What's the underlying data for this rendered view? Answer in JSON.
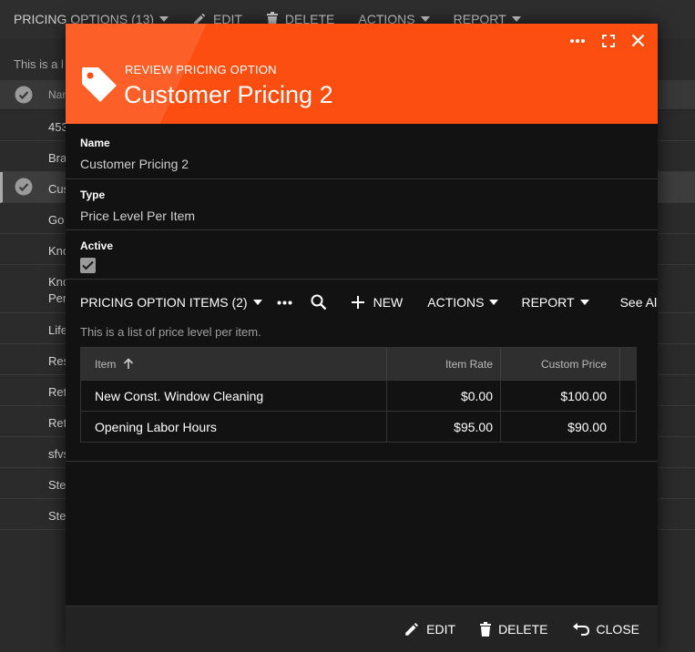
{
  "background": {
    "toolbar": {
      "list_title": "PRICING OPTIONS (13)",
      "edit": "EDIT",
      "delete": "DELETE",
      "actions": "ACTIONS",
      "report": "REPORT"
    },
    "description": "This is a l",
    "column_header": "Nar",
    "rows": [
      "453",
      "Bra",
      "Cus",
      "Go",
      "Kno",
      "Kno\nPer",
      "Life",
      "Res",
      "Ret",
      "Ret",
      "sfvs",
      "Ste",
      "Ste"
    ]
  },
  "modal": {
    "subtitle": "REVIEW PRICING OPTION",
    "title": "Customer Pricing 2",
    "fields": {
      "name_label": "Name",
      "name_value": "Customer Pricing 2",
      "type_label": "Type",
      "type_value": "Price Level Per Item",
      "active_label": "Active",
      "active_checked": true
    },
    "items_toolbar": {
      "title": "PRICING OPTION ITEMS (2)",
      "new": "NEW",
      "actions": "ACTIONS",
      "report": "REPORT",
      "see_all": "See All"
    },
    "items_description": "This is a list of price level per item.",
    "grid": {
      "headers": [
        "Item",
        "Item Rate",
        "Custom Price"
      ],
      "rows": [
        {
          "item": "New Const. Window Cleaning",
          "rate": "$0.00",
          "custom": "$100.00"
        },
        {
          "item": "Opening Labor Hours",
          "rate": "$95.00",
          "custom": "$90.00"
        }
      ]
    },
    "footer": {
      "edit": "EDIT",
      "delete": "DELETE",
      "close": "CLOSE"
    }
  },
  "colors": {
    "accent": "#fc4e10",
    "modal_bg": "#121212",
    "page_bg": "#2b2b2b"
  }
}
